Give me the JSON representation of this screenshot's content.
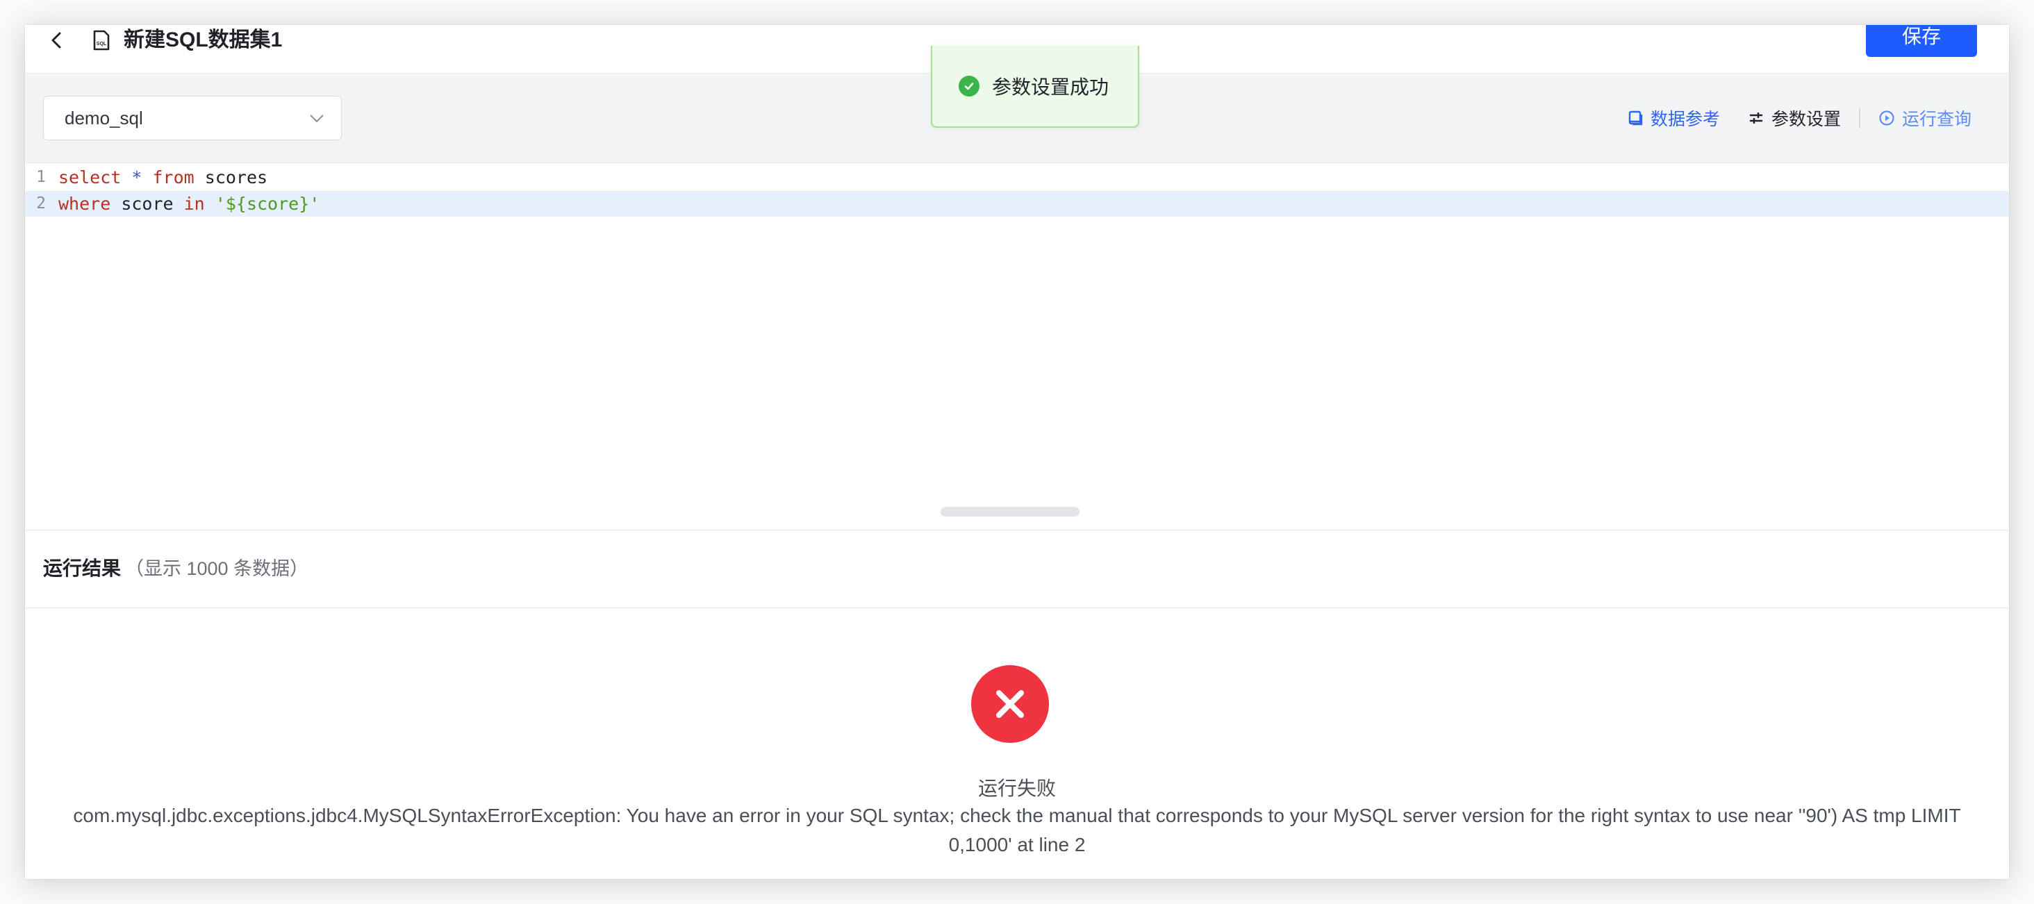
{
  "header": {
    "title": "新建SQL数据集1",
    "save_label": "保存"
  },
  "toolbar": {
    "datasource": "demo_sql",
    "data_ref_label": "数据参考",
    "param_settings_label": "参数设置",
    "run_query_label": "运行查询"
  },
  "editor": {
    "lines": [
      {
        "number": "1",
        "tokens": [
          "select",
          " ",
          "*",
          " ",
          "from",
          " scores"
        ]
      },
      {
        "number": "2",
        "tokens": [
          "where",
          " score ",
          "in",
          " ",
          "'${score}'"
        ]
      }
    ]
  },
  "results": {
    "title": "运行结果",
    "subtitle": "（显示 1000 条数据）",
    "error_title": "运行失败",
    "error_message": "com.mysql.jdbc.exceptions.jdbc4.MySQLSyntaxErrorException: You have an error in your SQL syntax; check the manual that corresponds to your MySQL server version for the right syntax to use near ''90') AS tmp LIMIT 0,1000' at line 2"
  },
  "toast": {
    "message": "参数设置成功"
  },
  "colors": {
    "primary": "#1f5cff",
    "error": "#ef3340",
    "success": "#39b54a",
    "active_line": "#e6f0fd"
  }
}
